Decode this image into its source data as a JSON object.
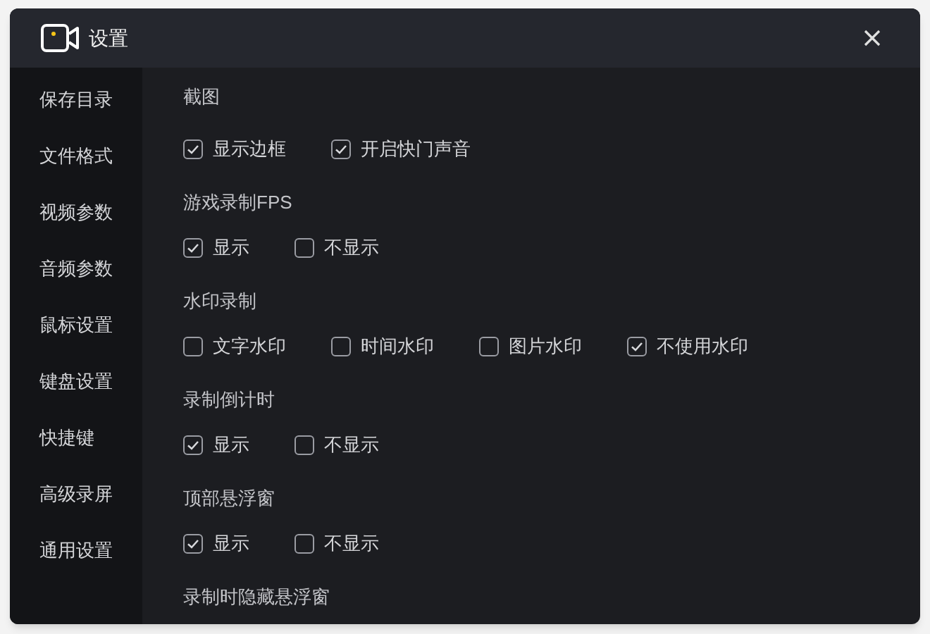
{
  "window": {
    "title": "设置"
  },
  "sidebar": {
    "items": [
      {
        "label": "保存目录"
      },
      {
        "label": "文件格式"
      },
      {
        "label": "视频参数"
      },
      {
        "label": "音频参数"
      },
      {
        "label": "鼠标设置"
      },
      {
        "label": "键盘设置"
      },
      {
        "label": "快捷键"
      },
      {
        "label": "高级录屏"
      },
      {
        "label": "通用设置"
      }
    ]
  },
  "sections": [
    {
      "title": "截图",
      "options": [
        {
          "label": "显示边框",
          "checked": true
        },
        {
          "label": "开启快门声音",
          "checked": true
        }
      ]
    },
    {
      "title": "游戏录制FPS",
      "options": [
        {
          "label": "显示",
          "checked": true
        },
        {
          "label": "不显示",
          "checked": false
        }
      ]
    },
    {
      "title": "水印录制",
      "options": [
        {
          "label": "文字水印",
          "checked": false
        },
        {
          "label": "时间水印",
          "checked": false
        },
        {
          "label": "图片水印",
          "checked": false
        },
        {
          "label": "不使用水印",
          "checked": true
        }
      ]
    },
    {
      "title": "录制倒计时",
      "options": [
        {
          "label": "显示",
          "checked": true
        },
        {
          "label": "不显示",
          "checked": false
        }
      ]
    },
    {
      "title": "顶部悬浮窗",
      "options": [
        {
          "label": "显示",
          "checked": true
        },
        {
          "label": "不显示",
          "checked": false
        }
      ]
    },
    {
      "title": "录制时隐藏悬浮窗"
    }
  ]
}
